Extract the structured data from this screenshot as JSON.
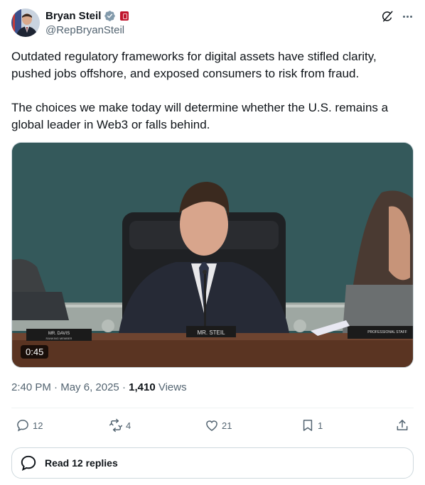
{
  "author": {
    "name": "Bryan Steil",
    "handle": "@RepBryanSteil",
    "verified_color": "#829aab",
    "gov_badge_color": "#c0162d"
  },
  "tweet": {
    "paragraphs": [
      "Outdated regulatory frameworks for digital assets have stifled clarity, pushed jobs offshore, and exposed consumers to risk from fraud.",
      "The choices we make today will determine whether the U.S. remains a global leader in Web3 or falls behind."
    ]
  },
  "media": {
    "duration": "0:45",
    "placards": {
      "left": "MR. DAVIS",
      "left_sub": "RANKING MEMBER",
      "center": "MR. STEIL",
      "right": "PROFESSIONAL STAFF"
    }
  },
  "meta": {
    "time": "2:40 PM",
    "separator": "·",
    "date": "May 6, 2025",
    "views_count": "1,410",
    "views_label": "Views"
  },
  "actions": {
    "replies": "12",
    "reposts": "4",
    "likes": "21",
    "bookmarks": "1"
  },
  "read_replies": {
    "label": "Read 12 replies"
  },
  "icons": {
    "verified": "verified-check-icon",
    "gov": "government-badge-icon",
    "grok": "grok-icon",
    "more": "more-dots-icon",
    "reply": "reply-bubble-icon",
    "repost": "repost-arrows-icon",
    "like": "heart-icon",
    "bookmark": "bookmark-icon",
    "share": "share-upload-icon"
  }
}
